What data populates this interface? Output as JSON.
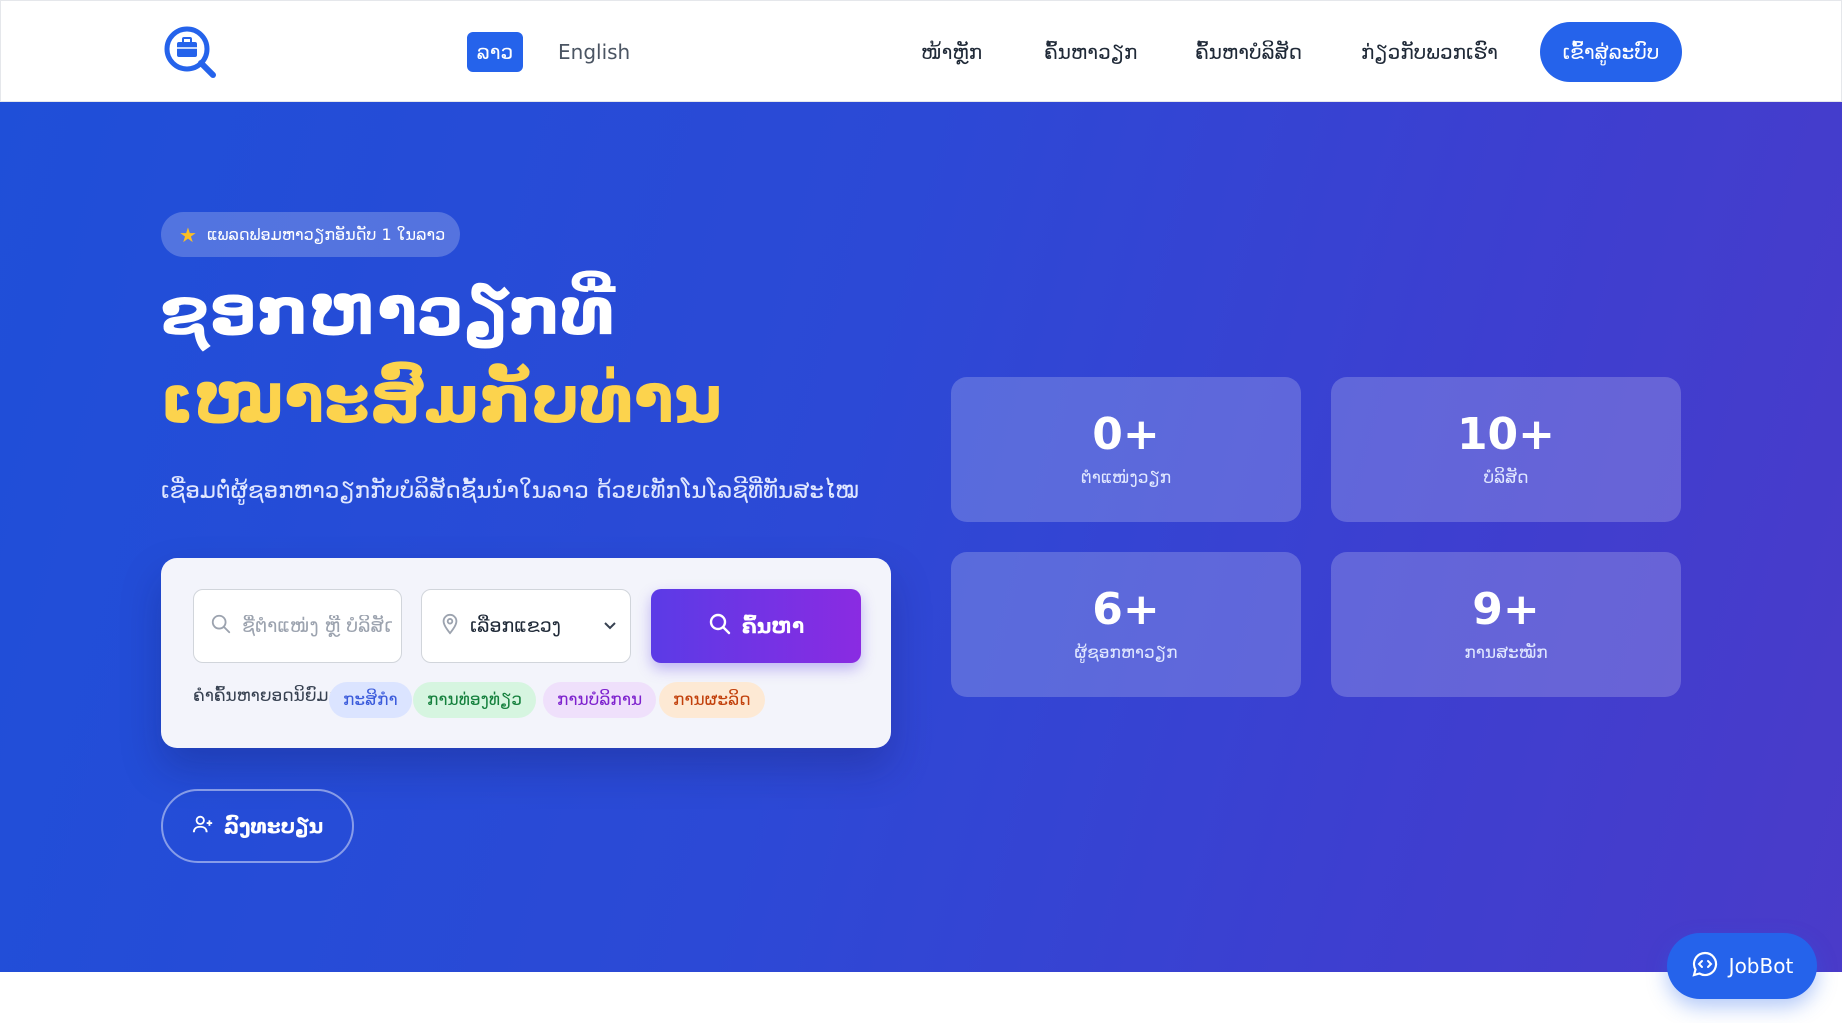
{
  "colors": {
    "primary": "#2563eb",
    "highlight": "#fcd34d",
    "search_button_gradient": [
      "#5b3be6",
      "#8a2be2"
    ]
  },
  "header": {
    "logo_icon": "briefcase-search-icon",
    "languages": {
      "lao": "ລາວ",
      "english": "English"
    },
    "nav": {
      "home": "ໜ້າຫຼັກ",
      "find_jobs": "ຄົ້ນຫາວຽກ",
      "find_companies": "ຄົ້ນຫາບໍລິສັດ",
      "about": "ກ່ຽວກັບພວກເຮົາ"
    },
    "login_label": "ເຂົ້າສູ່ລະບົບ"
  },
  "hero": {
    "badge": "ແພລດຟອມຫາວຽກອັນດັບ 1 ໃນລາວ",
    "title_line1": "ຊອກຫາວຽກທີ່",
    "title_line2": "ເໝາະສົມກັບທ່ານ",
    "subtitle": "ເຊື່ອມຕໍ່ຜູ້ຊອກຫາວຽກກັບບໍລິສັດຊັ້ນນຳໃນລາວ ດ້ວຍເທັກໂນໂລຊີທີ່ທັນສະໄໝ",
    "register_label": "ລົງທະບຽນ"
  },
  "search": {
    "keyword_placeholder": "ຊື່ຕຳແໜ່ງ ຫຼື ບໍລິສັດ",
    "province_selected": "ເລືອກແຂວງ",
    "button_label": "ຄົ້ນຫາ",
    "popular_label": "ຄຳຄົ້ນຫາຍອດນິຍົມ:",
    "popular_tags": [
      "ກະສິກຳ",
      "ການທ່ອງທ່ຽວ",
      "ການບໍລິການ",
      "ການຜະລິດ"
    ]
  },
  "stats": [
    {
      "value": "0+",
      "label": "ຕຳແໜ່ງວຽກ"
    },
    {
      "value": "10+",
      "label": "ບໍລິສັດ"
    },
    {
      "value": "6+",
      "label": "ຜູ້ຊອກຫາວຽກ"
    },
    {
      "value": "9+",
      "label": "ການສະໝັກ"
    }
  ],
  "chatbot": {
    "label": "JobBot"
  }
}
